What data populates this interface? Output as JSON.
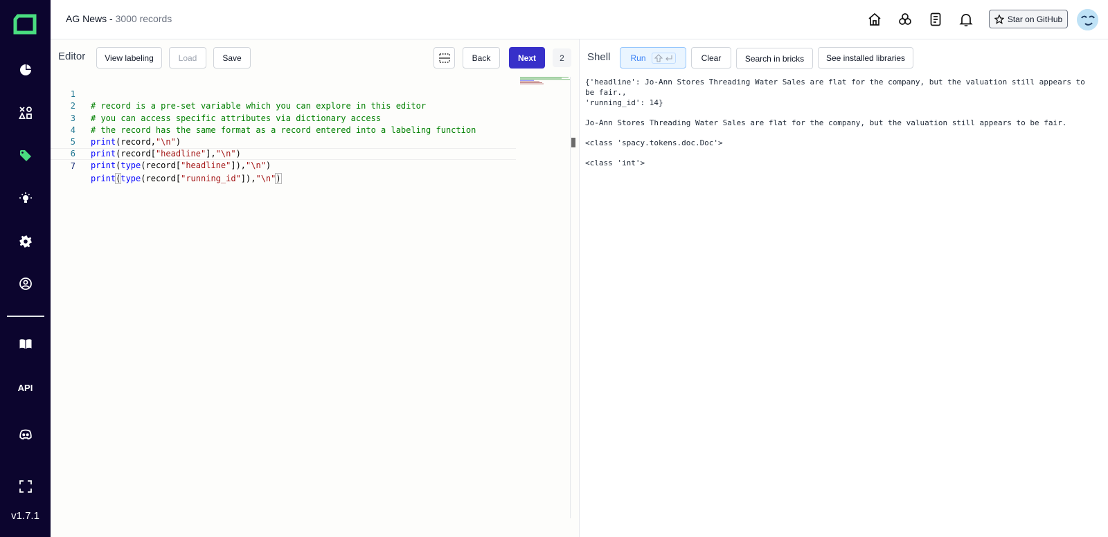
{
  "sidebar": {
    "version": "v1.7.1",
    "api_label": "API",
    "items": [
      {
        "name": "overview",
        "icon": "pie-chart-icon"
      },
      {
        "name": "data-browser",
        "icon": "shapes-icon"
      },
      {
        "name": "labeling",
        "icon": "tag-icon"
      },
      {
        "name": "heuristics",
        "icon": "lightbulb-icon"
      },
      {
        "name": "settings",
        "icon": "gear-icon"
      },
      {
        "name": "users",
        "icon": "user-circle-icon"
      },
      {
        "name": "docs",
        "icon": "book-icon"
      },
      {
        "name": "discord",
        "icon": "discord-icon"
      },
      {
        "name": "fullscreen",
        "icon": "fullscreen-icon"
      }
    ],
    "accent_color": "#4ade80"
  },
  "header": {
    "project_name": "AG News - ",
    "record_count": "3000 records",
    "github_label": "Star on GitHub"
  },
  "editor": {
    "label": "Editor",
    "view_labeling": "View labeling",
    "load": "Load",
    "save": "Save",
    "back": "Back",
    "next": "Next",
    "record_index": "2",
    "lines": [
      {
        "n": "1"
      },
      {
        "n": "2"
      },
      {
        "n": "3"
      },
      {
        "n": "4"
      },
      {
        "n": "5"
      },
      {
        "n": "6"
      },
      {
        "n": "7"
      }
    ],
    "code": {
      "l1": "# record is a pre-set variable which you can explore in this editor",
      "l2": "# you can access specific attributes via dictionary access",
      "l3": "# the record has the same format as a record entered into a labeling function",
      "print": "print",
      "type": "type",
      "record": "record",
      "headline": "\"headline\"",
      "running_id": "\"running_id\"",
      "newline": "\"\\n\""
    }
  },
  "shell": {
    "label": "Shell",
    "run": "Run",
    "clear": "Clear",
    "search_bricks": "Search in bricks",
    "installed_libs": "See installed libraries",
    "output": [
      "{'headline': Jo-Ann Stores Threading Water Sales are flat for the company, but the valuation still appears to be fair.,\n'running_id': 14}",
      "Jo-Ann Stores Threading Water Sales are flat for the company, but the valuation still appears to be fair.",
      "<class 'spacy.tokens.doc.Doc'>",
      "<class 'int'>"
    ]
  },
  "colors": {
    "primary": "#3730c9",
    "sidebar_bg": "#0c052e"
  }
}
